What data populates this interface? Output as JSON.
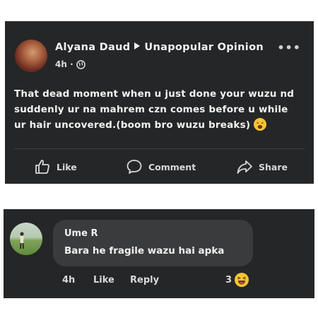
{
  "post": {
    "author": "Alyana Daud",
    "group": "Unapopular Opinion",
    "time": "4h",
    "more_label": "•••",
    "body": "That dead moment when u just done your wuzu  nd suddenly ur na mahrem czn comes before u while ur hair uncovered.(boom bro wuzu breaks)",
    "actions": {
      "like": "Like",
      "comment": "Comment",
      "share": "Share"
    }
  },
  "comment": {
    "author": "Ume R",
    "text": "Bara he fragile wazu hai apka",
    "time": "4h",
    "like_label": "Like",
    "reply_label": "Reply",
    "reaction_count": "3"
  },
  "colors": {
    "card_bg": "#252627",
    "bubble_bg": "#3a3b3c",
    "text": "#f2f2f2",
    "emoji": "#f7c531"
  }
}
